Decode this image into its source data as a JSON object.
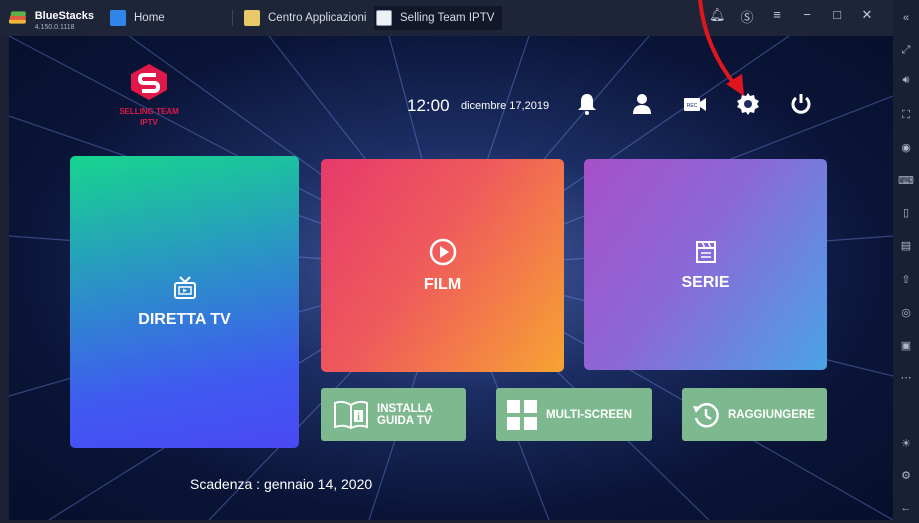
{
  "emulator": {
    "name": "BlueStacks",
    "version": "4.150.0.1118",
    "tabs": [
      {
        "label": "Home"
      },
      {
        "label": "Centro Applicazioni"
      },
      {
        "label": "Selling Team IPTV"
      }
    ],
    "window_controls": [
      "bell-icon",
      "coin-icon",
      "menu-icon",
      "minimize-icon",
      "maximize-icon",
      "close-icon",
      "collapse-icon"
    ],
    "sidebar_icons": [
      "fullscreen-icon",
      "volume-icon",
      "cursor-icon",
      "eye-icon",
      "keyboard-icon",
      "phone-icon",
      "gamepad-icon",
      "apk-icon",
      "screenshot-icon",
      "record-icon",
      "more-icon",
      "brightness-icon",
      "settings-icon",
      "back-icon"
    ]
  },
  "app": {
    "brand": {
      "line1": "SELLING TEAM",
      "line2": "IPTV",
      "color": "#e0194a"
    },
    "header": {
      "time": "12:00",
      "date": "dicembre 17,2019",
      "icons": [
        "bell-icon",
        "user-icon",
        "rec-icon",
        "settings-icon",
        "power-icon"
      ],
      "rec_label": "REC"
    },
    "tiles": {
      "live": {
        "label": "DIRETTA TV",
        "icon": "tv-icon"
      },
      "film": {
        "label": "FILM",
        "icon": "play-icon"
      },
      "serie": {
        "label": "SERIE",
        "icon": "clapper-icon"
      }
    },
    "buttons": {
      "guide": {
        "line1": "INSTALLA",
        "line2": "GUIDA TV",
        "icon": "guide-icon"
      },
      "multi": {
        "label": "MULTI-SCREEN",
        "icon": "grid-icon"
      },
      "add": {
        "label": "RAGGIUNGERE",
        "icon": "history-icon"
      }
    },
    "expiry": "Scadenza : gennaio 14, 2020",
    "accent_button_color": "#7db88e"
  }
}
